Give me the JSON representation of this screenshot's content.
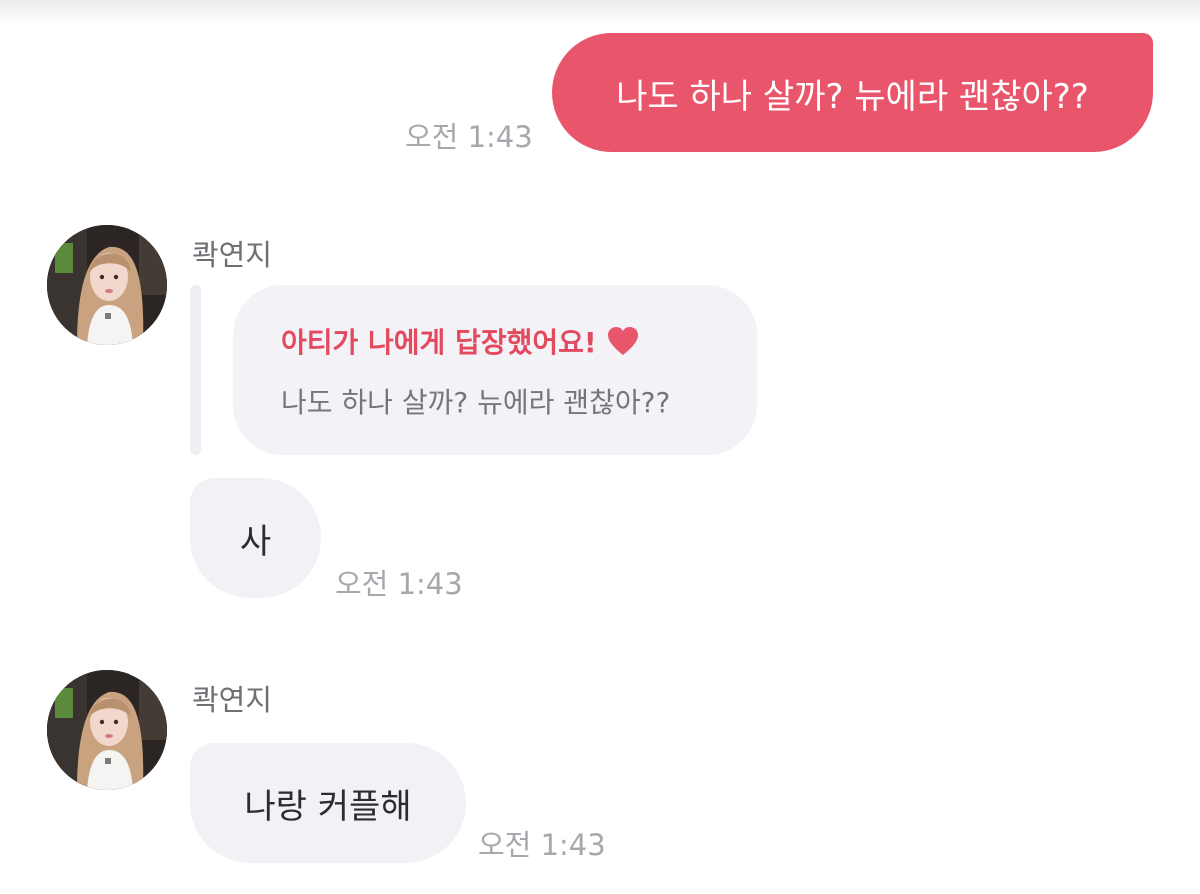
{
  "thread": {
    "outgoing_message": {
      "text": "나도 하나 살까? 뉴에라 괜찮아??",
      "time": "오전 1:43"
    },
    "incoming_group_1": {
      "sender_name": "콱연지",
      "reply_card": {
        "title": "아티가 나에게 답장했어요!",
        "quoted_text": "나도 하나 살까? 뉴에라 괜찮아??"
      },
      "message": {
        "text": "사",
        "time": "오전 1:43"
      }
    },
    "incoming_group_2": {
      "sender_name": "콱연지",
      "message": {
        "text": "나랑 커플해",
        "time": "오전 1:43"
      }
    }
  },
  "colors": {
    "outgoing_bubble": "#e9566b",
    "incoming_bubble": "#f2f2f6",
    "reply_title": "#e44a5f",
    "timestamp": "#a7a7ad",
    "heart": "#e9566b"
  },
  "icons": {
    "reply_heart": "heart-icon"
  }
}
